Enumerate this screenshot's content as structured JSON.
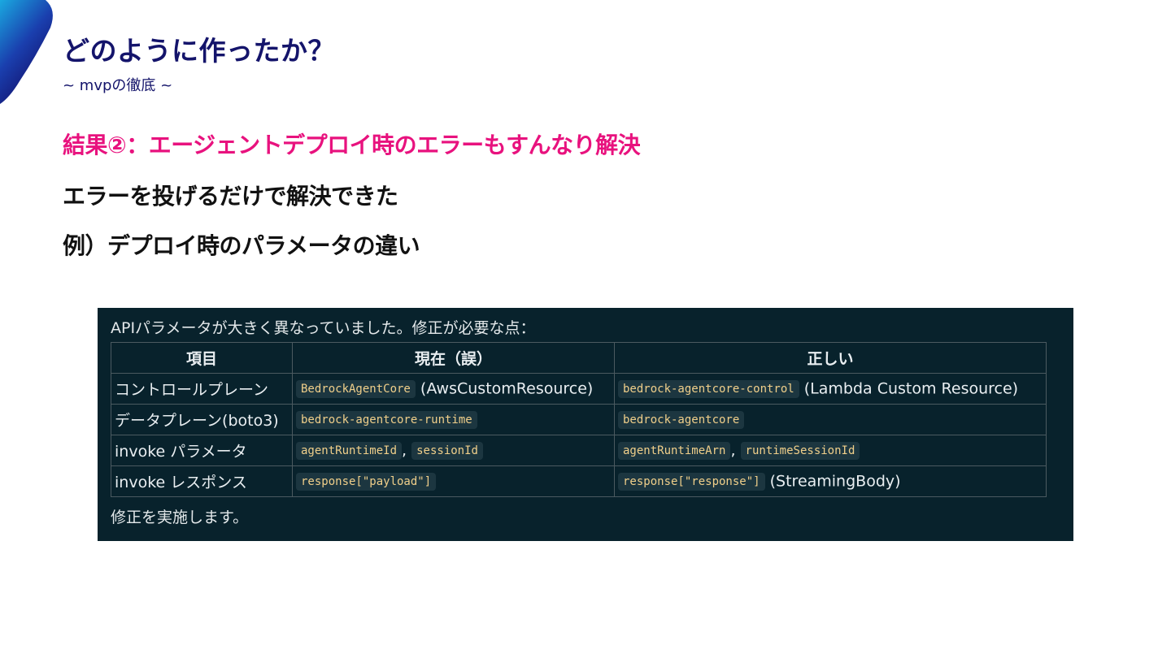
{
  "slide": {
    "title": "どのように作ったか？",
    "subtitle": "~ mvpの徹底 ~",
    "result_heading": "結果②：エージェントデプロイ時のエラーもすんなり解決",
    "line1": "エラーを投げるだけで解決できた",
    "line2": "例）デプロイ時のパラメータの違い"
  },
  "panel": {
    "intro": "APIパラメータが大きく異なっていました。修正が必要な点：",
    "outro": "修正を実施します。",
    "headers": [
      "項目",
      "現在（誤）",
      "正しい"
    ],
    "rows": [
      {
        "item": "コントロールプレーン",
        "current_code": "BedrockAgentCore",
        "current_note": "(AwsCustomResource)",
        "correct_code": "bedrock-agentcore-control",
        "correct_note": "(Lambda Custom Resource)"
      },
      {
        "item": "データプレーン(boto3)",
        "current_code": "bedrock-agentcore-runtime",
        "correct_code": "bedrock-agentcore"
      },
      {
        "item": "invoke パラメータ",
        "current_code_1": "agentRuntimeId",
        "current_code_2": "sessionId",
        "correct_code_1": "agentRuntimeArn",
        "correct_code_2": "runtimeSessionId",
        "separator": ","
      },
      {
        "item": "invoke レスポンス",
        "current_code": "response[\"payload\"]",
        "correct_code": "response[\"response\"]",
        "correct_note": "(StreamingBody)"
      }
    ]
  },
  "colors": {
    "title": "#14146b",
    "result": "#e8127e",
    "panel_bg": "#08222c",
    "code_text": "#f0cf8a"
  }
}
